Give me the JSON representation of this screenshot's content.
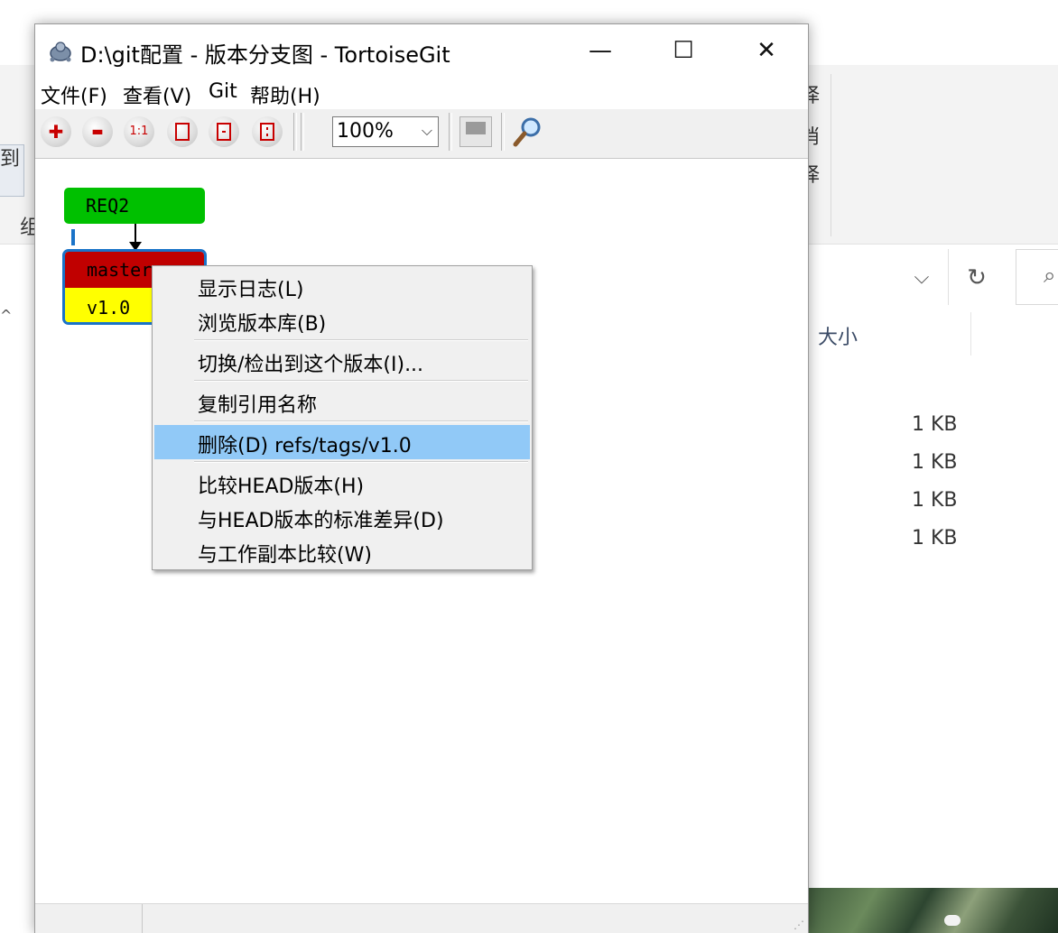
{
  "window": {
    "title": "D:\\git配置 - 版本分支图 - TortoiseGit",
    "minimize": "—",
    "maximize": "☐",
    "close": "✕"
  },
  "menubar": [
    {
      "label": "文件(F)"
    },
    {
      "label": "查看(V)"
    },
    {
      "label": "Git"
    },
    {
      "label": "帮助(H)"
    }
  ],
  "toolbar": {
    "zoom_in_glyph": "✚",
    "zoom_out_glyph": "▬",
    "zoom_1to1_glyph": "1:1",
    "zoom_value": "100%",
    "zoom_arrow": "⌵"
  },
  "graph": {
    "nodes": [
      {
        "ref": "REQ2",
        "color": "#00c000"
      },
      {
        "ref": "master",
        "color": "#c00000"
      },
      {
        "ref": "v1.0",
        "color": "#ffff00"
      }
    ]
  },
  "context_menu": {
    "items": [
      {
        "label": "显示日志(L)"
      },
      {
        "label": "浏览版本库(B)"
      },
      {
        "label": "切换/检出到这个版本(I)..."
      },
      {
        "label": "复制引用名称"
      },
      {
        "label": "删除(D) refs/tags/v1.0",
        "highlighted": true
      },
      {
        "label": "比较HEAD版本(H)"
      },
      {
        "label": "与HEAD版本的标准差异(D)"
      },
      {
        "label": "与工作副本比较(W)"
      }
    ]
  },
  "explorer": {
    "ribbon_left_text": "到",
    "ribbon_left_group": "组",
    "ribbon_right_glyphs": [
      "择",
      "消",
      "择"
    ],
    "column_header_size": "大小",
    "file_sizes": [
      "1 KB",
      "1 KB",
      "1 KB",
      "1 KB"
    ],
    "collapse_caret": "^",
    "address_dropdown": "⌵",
    "refresh": "↻",
    "search_icon_glyph": "⌕"
  }
}
